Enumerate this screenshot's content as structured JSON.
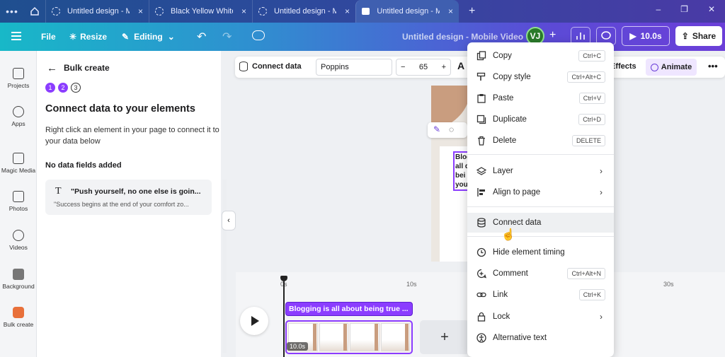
{
  "browser": {
    "tabs": [
      {
        "title": "Untitled design - M...",
        "active": false
      },
      {
        "title": "Black Yellow White...",
        "active": false
      },
      {
        "title": "Untitled design - M...",
        "active": false
      },
      {
        "title": "Untitled design - M...",
        "active": true
      }
    ],
    "close_glyph": "×",
    "new_tab_glyph": "+",
    "menu_glyph": "•••",
    "win_min": "–",
    "win_max": "❐",
    "win_close": "✕"
  },
  "toolbar": {
    "file": "File",
    "resize": "Resize",
    "editing": "Editing",
    "design_title": "Untitled design - Mobile Video",
    "avatar_initials": "VJ",
    "play_duration": "10.0s",
    "share": "Share"
  },
  "rail": {
    "items": [
      {
        "label": "Projects",
        "icon": "folder-icon"
      },
      {
        "label": "Apps",
        "icon": "apps-grid-icon"
      },
      {
        "label": "Magic Media",
        "icon": "magic-media-icon"
      },
      {
        "label": "Photos",
        "icon": "photos-icon"
      },
      {
        "label": "Videos",
        "icon": "videos-icon"
      },
      {
        "label": "Background",
        "icon": "background-icon"
      },
      {
        "label": "Bulk create",
        "icon": "bulk-create-icon"
      }
    ]
  },
  "panel": {
    "title": "Bulk create",
    "steps": [
      "1",
      "2",
      "3"
    ],
    "heading": "Connect data to your elements",
    "description": "Right click an element in your page to connect it to your data below",
    "no_fields": "No data fields added",
    "card_line1": "\"Push yourself, no one else is goin...",
    "card_line2": "\"Success begins at the end of your comfort zo..."
  },
  "context_bar": {
    "connect_data": "Connect data",
    "font": "Poppins",
    "font_size": "65",
    "minus": "−",
    "plus": "+",
    "text_color_glyph": "A",
    "effects": "Effects",
    "animate": "Animate",
    "more": "•••"
  },
  "canvas": {
    "quote_mark": "“",
    "snippet": [
      "Blogg",
      "all d",
      "bei",
      "you"
    ]
  },
  "timeline": {
    "ticks": [
      "0s",
      "10s",
      "30s"
    ],
    "text_clip": "Blogging is all about being true ...",
    "video_duration": "10.0s",
    "add": "+"
  },
  "menu": {
    "items": [
      {
        "label": "Copy",
        "shortcut": "Ctrl+C",
        "icon": "copy-icon"
      },
      {
        "label": "Copy style",
        "shortcut": "Ctrl+Alt+C",
        "icon": "paint-roller-icon"
      },
      {
        "label": "Paste",
        "shortcut": "Ctrl+V",
        "icon": "clipboard-icon"
      },
      {
        "label": "Duplicate",
        "shortcut": "Ctrl+D",
        "icon": "duplicate-icon"
      },
      {
        "label": "Delete",
        "shortcut": "DELETE",
        "icon": "trash-icon"
      },
      {
        "label": "Layer",
        "shortcut": "",
        "icon": "layers-icon",
        "submenu": true
      },
      {
        "label": "Align to page",
        "shortcut": "",
        "icon": "align-icon",
        "submenu": true
      },
      {
        "label": "Connect data",
        "shortcut": "",
        "icon": "database-icon",
        "hover": true
      },
      {
        "label": "Hide element timing",
        "shortcut": "",
        "icon": "clock-icon"
      },
      {
        "label": "Comment",
        "shortcut": "Ctrl+Alt+N",
        "icon": "comment-plus-icon"
      },
      {
        "label": "Link",
        "shortcut": "Ctrl+K",
        "icon": "link-icon"
      },
      {
        "label": "Lock",
        "shortcut": "",
        "icon": "lock-icon",
        "submenu": true
      },
      {
        "label": "Alternative text",
        "shortcut": "",
        "icon": "accessibility-icon"
      }
    ],
    "chevron": "›"
  },
  "colors": {
    "brand_purple": "#8b3dff",
    "topbar_start": "#18b8c8",
    "topbar_end": "#6b3fd8"
  }
}
